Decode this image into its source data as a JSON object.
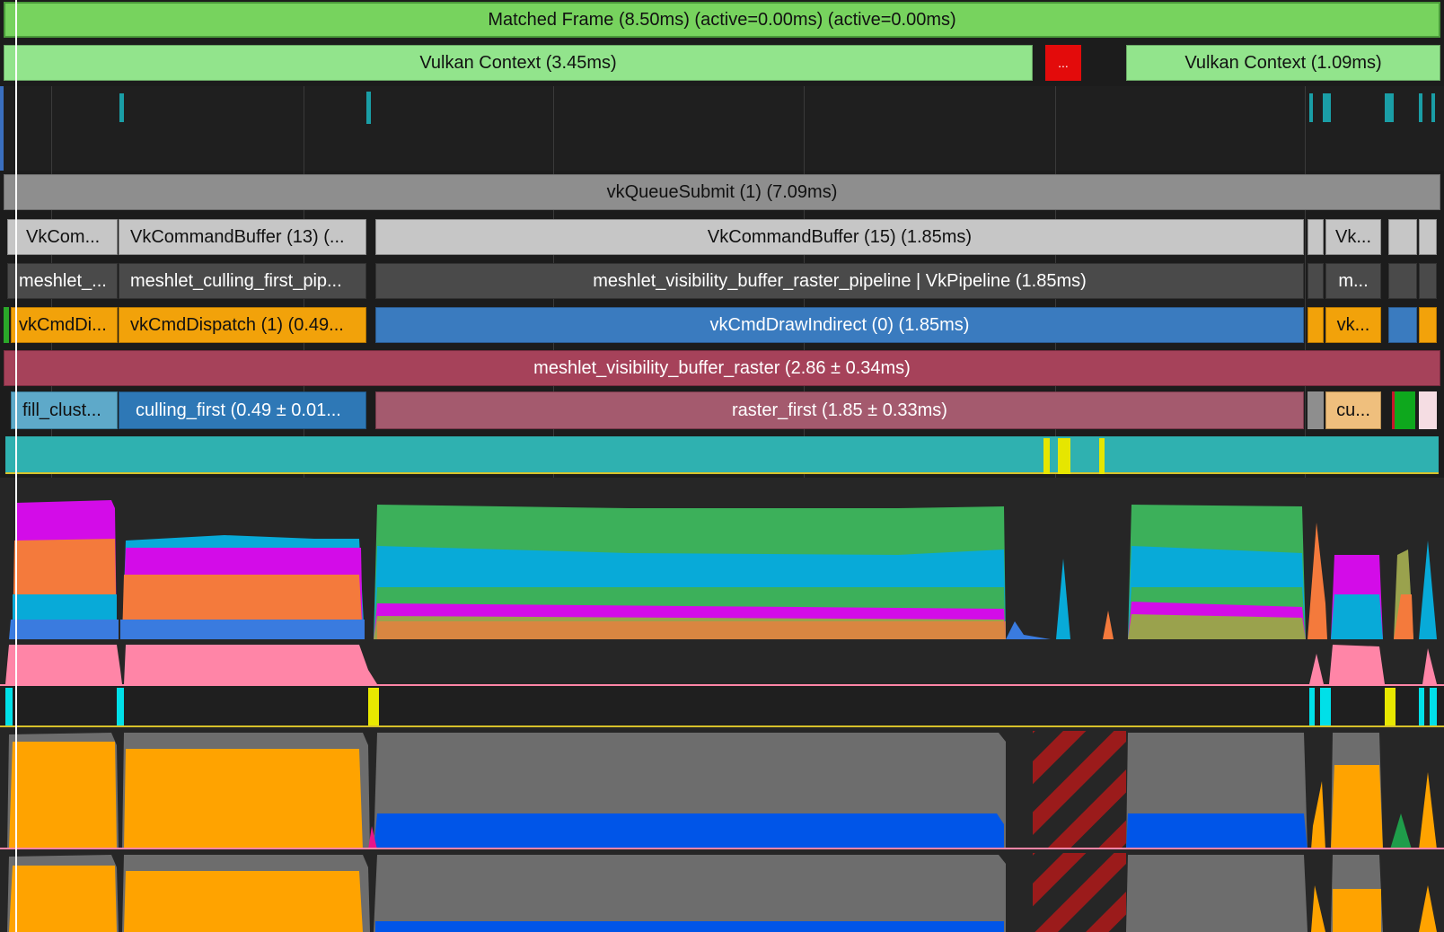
{
  "frame": {
    "label": "Matched Frame (8.50ms) (active=0.00ms) (active=0.00ms)",
    "color": "#77d35e"
  },
  "vulkan_context_1": {
    "label": "Vulkan Context (3.45ms)",
    "color": "#92e48c"
  },
  "vulkan_context_collapsed": {
    "label": "...",
    "color": "#e30b0b"
  },
  "vulkan_context_2": {
    "label": "Vulkan Context (1.09ms)",
    "color": "#92e48c"
  },
  "queue_submit": {
    "label": "vkQueueSubmit (1) (7.09ms)",
    "color": "#8e8e8e"
  },
  "command_buffers": {
    "color": "#c6c6c6",
    "items": [
      {
        "label": "VkCom..."
      },
      {
        "label": "VkCommandBuffer (13) (..."
      },
      {
        "label": "VkCommandBuffer (15) (1.85ms)"
      },
      {
        "label": ""
      },
      {
        "label": "Vk..."
      },
      {
        "label": ""
      },
      {
        "label": ""
      }
    ]
  },
  "pipelines": {
    "color": "#4a4a4a",
    "items": [
      {
        "label": "meshlet_..."
      },
      {
        "label": "meshlet_culling_first_pip..."
      },
      {
        "label": "meshlet_visibility_buffer_raster_pipeline | VkPipeline (1.85ms)"
      },
      {
        "label": "m..."
      }
    ]
  },
  "commands": {
    "items": [
      {
        "label": "vkCmdDi...",
        "color": "#f2a20a"
      },
      {
        "label": "vkCmdDispatch (1) (0.49...",
        "color": "#f2a20a"
      },
      {
        "label": "vkCmdDrawIndirect (0) (1.85ms)",
        "color": "#3a7bbf"
      },
      {
        "label": "vk...",
        "color": "#f2a20a"
      }
    ]
  },
  "raster_group": {
    "label": "meshlet_visibility_buffer_raster (2.86 ± 0.34ms)",
    "color": "#a6425a"
  },
  "passes": {
    "items": [
      {
        "label": "fill_clust...",
        "color": "#5ea9c9"
      },
      {
        "label": "culling_first (0.49 ± 0.01...",
        "color": "#2e78b6"
      },
      {
        "label": "raster_first (1.85 ± 0.33ms)",
        "color": "#a45a6e"
      },
      {
        "label": "cu...",
        "color": "#efbf7d"
      }
    ]
  },
  "colors": {
    "teal_track": "#2fb1b0",
    "pink_track": "#ff85a7",
    "orange_fill": "#ffa300",
    "grey_fill": "#6d6d6d",
    "blue_fill": "#0055e8",
    "green_stack": "#3cb05a",
    "cyan_stack": "#08aad8",
    "magenta_stack": "#d30ce8",
    "coral_stack": "#f47a3c",
    "hazard_red": "#9b1b1b"
  }
}
